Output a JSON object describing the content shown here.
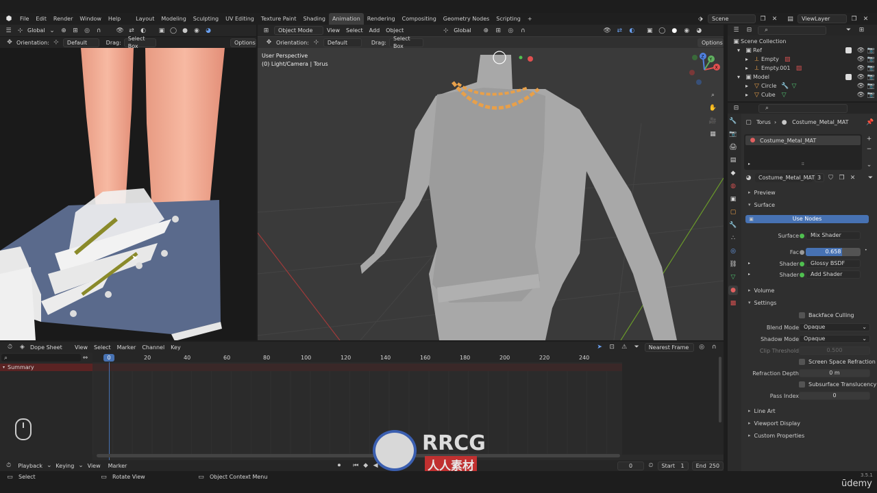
{
  "topbar": {
    "menu": [
      "File",
      "Edit",
      "Render",
      "Window",
      "Help"
    ],
    "workspaces": [
      "Layout",
      "Modeling",
      "Sculpting",
      "UV Editing",
      "Texture Paint",
      "Shading",
      "Animation",
      "Rendering",
      "Compositing",
      "Geometry Nodes",
      "Scripting"
    ],
    "active_workspace": "Animation",
    "add_tab": "+",
    "scene": "Scene",
    "view_layer": "ViewLayer"
  },
  "left_viewport": {
    "transform": "Global",
    "orientation_label": "Orientation:",
    "orientation": "Default",
    "drag_label": "Drag:",
    "drag": "Select Box",
    "options": "Options"
  },
  "main_viewport": {
    "mode": "Object Mode",
    "menu": [
      "View",
      "Select",
      "Add",
      "Object"
    ],
    "transform": "Global",
    "orientation_label": "Orientation:",
    "orientation": "Default",
    "drag_label": "Drag:",
    "drag": "Select Box",
    "options": "Options",
    "info_line1": "User Perspective",
    "info_line2": "(0) Light/Camera | Torus",
    "gizmo_axes": [
      "X",
      "Y",
      "Z"
    ]
  },
  "outliner": {
    "title": "Scene Collection",
    "items": [
      {
        "name": "Ref",
        "level": 1
      },
      {
        "name": "Empty",
        "level": 2
      },
      {
        "name": "Empty.001",
        "level": 2
      },
      {
        "name": "Model",
        "level": 1
      },
      {
        "name": "Circle",
        "level": 2
      },
      {
        "name": "Cube",
        "level": 2
      }
    ]
  },
  "properties": {
    "breadcrumb_object": "Torus",
    "breadcrumb_material": "Costume_Metal_MAT",
    "material_slot": "Costume_Metal_MAT",
    "material_name": "Costume_Metal_MAT",
    "user_count": "3",
    "sections": {
      "preview": "Preview",
      "surface": "Surface",
      "volume": "Volume",
      "settings": "Settings",
      "line_art": "Line Art",
      "viewport_display": "Viewport Display",
      "custom_properties": "Custom Properties"
    },
    "use_nodes": "Use Nodes",
    "surface_label": "Surface",
    "surface_value": "Mix Shader",
    "fac_label": "Fac",
    "fac_value": "0.658",
    "fac_fraction": 0.658,
    "shader1_label": "Shader",
    "shader1_value": "Glossy BSDF",
    "shader2_label": "Shader",
    "shader2_value": "Add Shader",
    "backface_culling": "Backface Culling",
    "blend_mode_label": "Blend Mode",
    "blend_mode": "Opaque",
    "shadow_mode_label": "Shadow Mode",
    "shadow_mode": "Opaque",
    "clip_threshold_label": "Clip Threshold",
    "clip_threshold": "0.500",
    "screen_space_refraction": "Screen Space Refraction",
    "refraction_depth_label": "Refraction Depth",
    "refraction_depth": "0 m",
    "subsurface_translucency": "Subsurface Translucency",
    "pass_index_label": "Pass Index",
    "pass_index": "0"
  },
  "dope_sheet": {
    "editor": "Dope Sheet",
    "menu": [
      "View",
      "Select",
      "Marker",
      "Channel",
      "Key"
    ],
    "snapping": "Nearest Frame",
    "current_frame_marker": "0",
    "ruler": [
      "20",
      "40",
      "60",
      "80",
      "100",
      "120",
      "140",
      "160",
      "180",
      "200",
      "220",
      "240"
    ],
    "summary": "Summary"
  },
  "timeline": {
    "menu": [
      "Playback",
      "Keying",
      "View",
      "Marker"
    ],
    "current_frame": "0",
    "start_label": "Start",
    "start": "1",
    "end_label": "End",
    "end": "250"
  },
  "statusbar": {
    "select": "Select",
    "rotate": "Rotate View",
    "context_menu": "Object Context Menu",
    "version": "3.5.1",
    "udemy": "ūdemy"
  },
  "watermark": {
    "brand": "RRCG",
    "sub": "人人素材"
  },
  "colors": {
    "accent": "#4772b3",
    "selection_orange": "#e8a04a",
    "header": "#262626",
    "viewport_bg": "#3a3a3a"
  }
}
